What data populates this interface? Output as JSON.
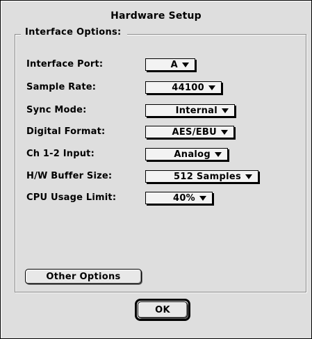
{
  "dialog": {
    "title": "Hardware Setup",
    "group_label": "Interface Options:"
  },
  "settings": [
    {
      "label": "Interface Port:",
      "value": "A"
    },
    {
      "label": "Sample Rate:",
      "value": "44100"
    },
    {
      "label": "Sync Mode:",
      "value": "Internal"
    },
    {
      "label": "Digital Format:",
      "value": "AES/EBU"
    },
    {
      "label": "Ch 1-2 Input:",
      "value": "Analog"
    },
    {
      "label": "H/W Buffer Size:",
      "value": "512 Samples"
    },
    {
      "label": "CPU Usage Limit:",
      "value": "40%"
    }
  ],
  "buttons": {
    "other_options": "Other Options",
    "ok": "OK"
  },
  "icons": {
    "popup_arrow": "triangle-down-icon"
  }
}
